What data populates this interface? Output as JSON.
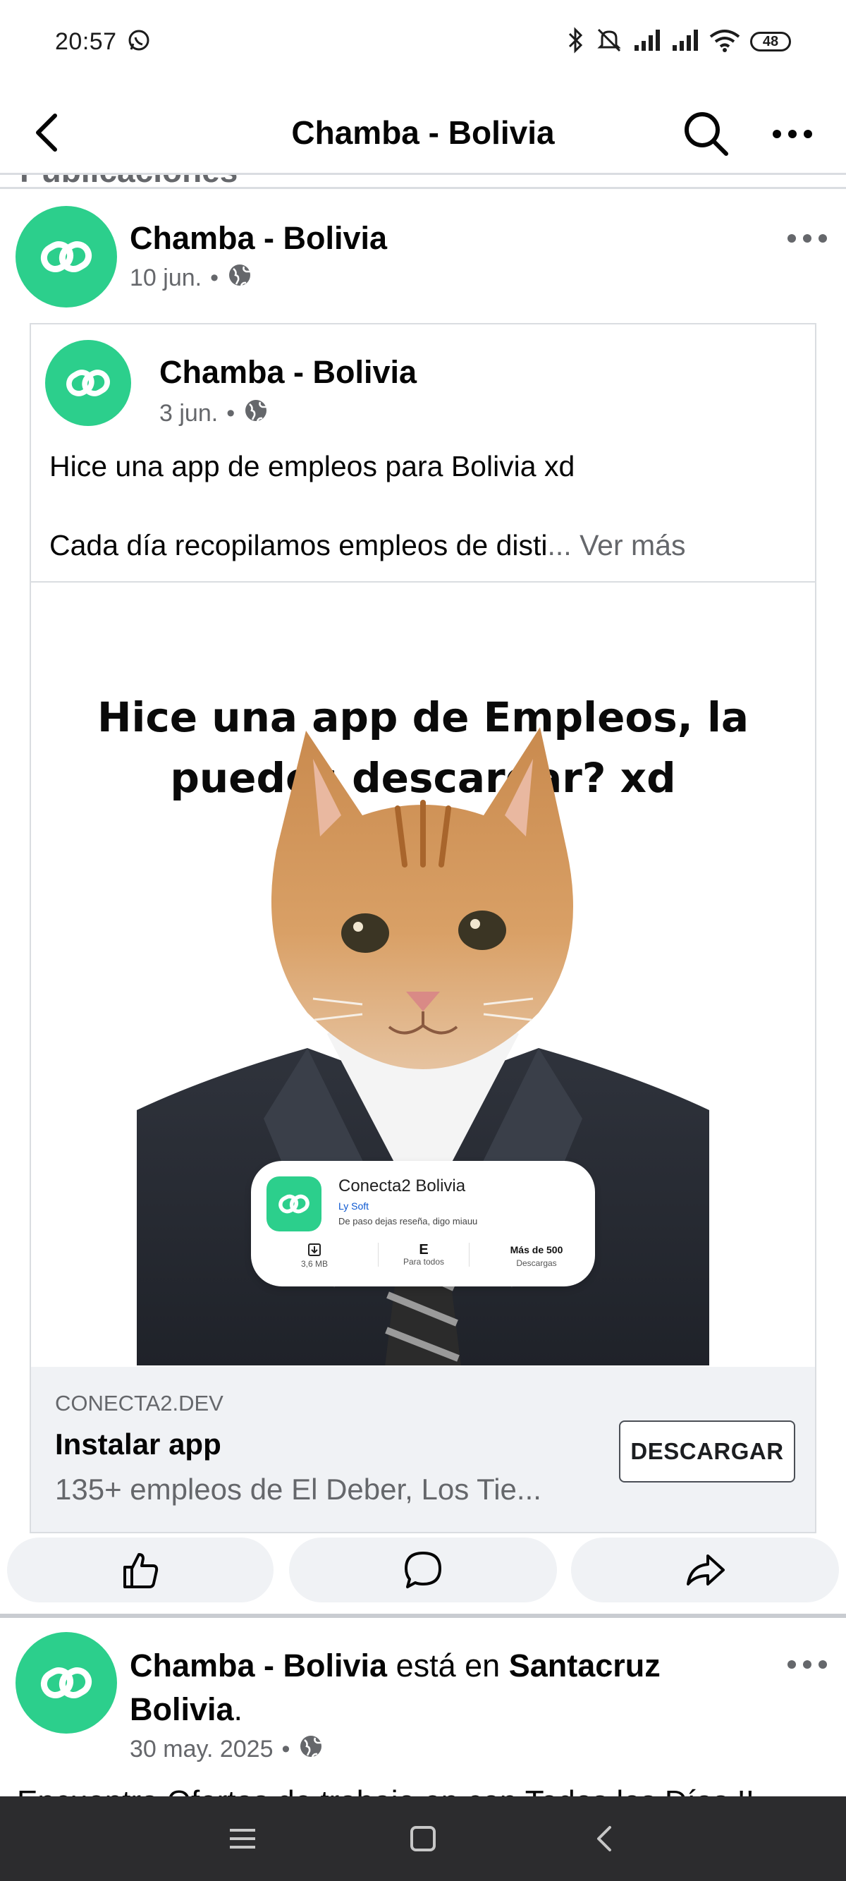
{
  "status_bar": {
    "time": "20:57",
    "battery": "48",
    "icons": [
      "whatsapp-icon",
      "bluetooth-icon",
      "mute-icon",
      "signal-icon",
      "signal-icon",
      "wifi-icon",
      "battery-icon"
    ]
  },
  "nav": {
    "title": "Chamba - Bolivia",
    "icons": [
      "back-arrow-icon",
      "search-icon",
      "more-horizontal-icon"
    ]
  },
  "section_peek": "Publicaciones",
  "post": {
    "author": "Chamba - Bolivia",
    "date": "10 jun.",
    "separator": "•",
    "privacy_icon": "globe-icon",
    "shared": {
      "author": "Chamba - Bolivia",
      "date": "3 jun.",
      "separator": "•",
      "text_line1": "Hice una app de empleos para Bolivia xd",
      "text_line2": "Cada día recopilamos empleos de disti",
      "ellipsis": "...",
      "see_more": "Ver más",
      "image": {
        "caption_line1": "Hice una app de Empleos, la",
        "caption_line2": "puedes descargar? xd",
        "app_card": {
          "app_name": "Conecta2 Bolivia",
          "developer": "Ly Soft",
          "tagline": "De paso dejas reseña, digo miauu",
          "size": "3,6 MB",
          "rating_letter": "E",
          "rating": "Para todos",
          "downloads": "Más de 500",
          "downloads_label": "Descargas"
        }
      },
      "link": {
        "domain": "CONECTA2.DEV",
        "title": "Instalar app",
        "description": "135+ empleos de El Deber, Los Tie...",
        "button": "DESCARGAR"
      }
    },
    "actions": [
      "like-icon",
      "comment-icon",
      "share-icon"
    ]
  },
  "post2": {
    "author": "Chamba - Bolivia",
    "connector": " está en ",
    "place_line1": "Santacruz",
    "place_line2": "Bolivia",
    "period": ".",
    "date": "30 may. 2025",
    "separator": "•",
    "cut_text": "Encuentra Ofertas de trabajo en con Todos los Días !!"
  },
  "bottom_nav": [
    "menu-icon",
    "home-icon",
    "back-icon"
  ],
  "colors": {
    "brand_green": "#2ccf8c",
    "secondary_text": "#65676b",
    "divider": "#dadde1",
    "footer_bg": "#f0f2f5",
    "system_nav": "#2c2c2e"
  }
}
